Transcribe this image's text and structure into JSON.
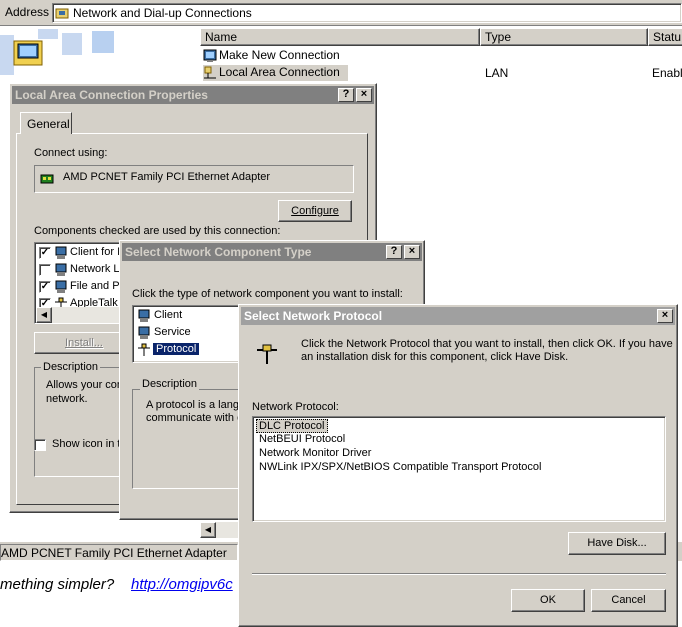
{
  "address_bar": {
    "label": "Address",
    "value": "Network and Dial-up Connections"
  },
  "explorer": {
    "columns": [
      "Name",
      "Type",
      "Statu"
    ],
    "rows": [
      {
        "name": "Make New Connection",
        "type": "",
        "status": ""
      },
      {
        "name": "Local Area Connection",
        "type": "LAN",
        "status": "Enabl"
      }
    ],
    "status_text": "AMD PCNET Family PCI Ethernet Adapter",
    "bottom_text": "mething simpler?",
    "bottom_link": "http://omgipv6c"
  },
  "lac_dialog": {
    "title": "Local Area Connection Properties",
    "tab_general": "General",
    "connect_using_label": "Connect using:",
    "adapter_name": "AMD PCNET Family PCI Ethernet Adapter",
    "configure_button": "Configure",
    "components_label": "Components checked are used by this connection:",
    "components": [
      {
        "label": "Client for M",
        "checked": true
      },
      {
        "label": "Network L",
        "checked": false
      },
      {
        "label": "File and P",
        "checked": true
      },
      {
        "label": "AppleTalk",
        "checked": true
      }
    ],
    "install_button": "Install...",
    "description_label": "Description",
    "description_text_1": "Allows your con",
    "description_text_2": "network.",
    "show_icon_label": "Show icon in t"
  },
  "snct_dialog": {
    "title": "Select Network Component Type",
    "prompt": "Click the type of network component you want to install:",
    "items": [
      "Client",
      "Service",
      "Protocol"
    ],
    "selected_index": 2,
    "description_label": "Description",
    "description_text_1": "A protocol is a langu",
    "description_text_2": "communicate with o"
  },
  "snp_dialog": {
    "title": "Select Network Protocol",
    "instructions_1": "Click the Network Protocol that you want to install, then click OK. If you have",
    "instructions_2": "an installation disk for this component, click Have Disk.",
    "list_label": "Network Protocol:",
    "protocols": [
      "DLC Protocol",
      "NetBEUI Protocol",
      "Network Monitor Driver",
      "NWLink IPX/SPX/NetBIOS Compatible Transport Protocol"
    ],
    "selected_index": 0,
    "have_disk_button": "Have Disk...",
    "ok_button": "OK",
    "cancel_button": "Cancel"
  },
  "colors": {
    "window_bg": "#d4d0c8",
    "inactive_title": "#808080",
    "active_title": "#a0a0a0",
    "selection": "#0a246a",
    "link": "#0000ee"
  }
}
